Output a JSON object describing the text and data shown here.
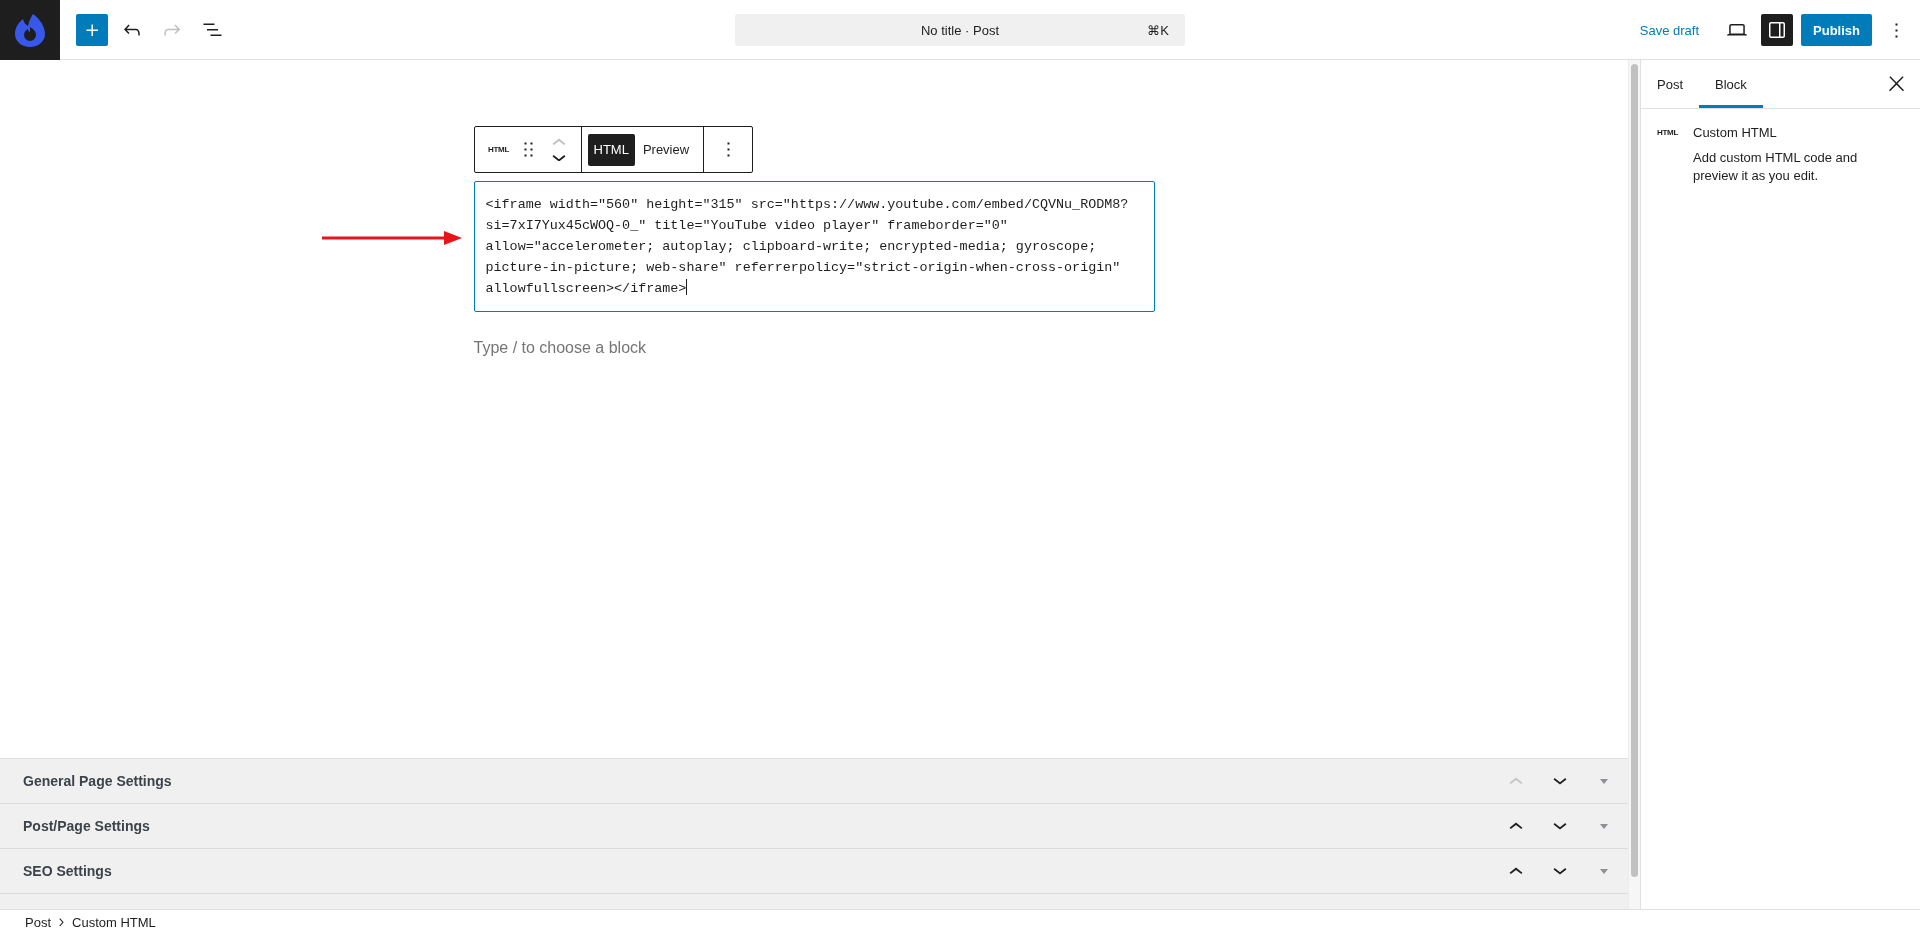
{
  "topbar": {
    "undo_disabled": false,
    "redo_disabled": true,
    "command_bar": {
      "title": "No title · Post",
      "shortcut": "⌘K"
    },
    "save_draft": "Save draft",
    "settings_pressed": true,
    "publish": "Publish"
  },
  "block_toolbar": {
    "block_icon": "HTML",
    "move_up_disabled": true,
    "move_down_disabled": false,
    "modes": [
      {
        "label": "HTML",
        "selected": true
      },
      {
        "label": "Preview",
        "selected": false
      }
    ]
  },
  "code_block": {
    "lines": [
      "<iframe width=\"560\" height=\"315\" src=\"https://www.youtube.com/embed/CQVNu_RODM8?",
      "si=7xI7Yux45cWOQ-0_\" title=\"YouTube video player\" frameborder=\"0\"",
      "allow=\"accelerometer; autoplay; clipboard-write; encrypted-media; gyroscope;",
      "picture-in-picture; web-share\" referrerpolicy=\"strict-origin-when-cross-origin\"",
      "allowfullscreen></iframe>"
    ]
  },
  "placeholder": "Type / to choose a block",
  "meta_panels": [
    {
      "title": "General Page Settings",
      "move_up_disabled": true,
      "move_down_disabled": false
    },
    {
      "title": "Post/Page Settings",
      "move_up_disabled": false,
      "move_down_disabled": false
    },
    {
      "title": "SEO Settings",
      "move_up_disabled": false,
      "move_down_disabled": false
    }
  ],
  "sidebar": {
    "tabs": [
      {
        "label": "Post",
        "selected": false
      },
      {
        "label": "Block",
        "selected": true
      }
    ],
    "block_card": {
      "icon": "HTML",
      "title": "Custom HTML",
      "description": "Add custom HTML code and preview it as you edit."
    }
  },
  "breadcrumbs": [
    "Post",
    "Custom HTML"
  ]
}
